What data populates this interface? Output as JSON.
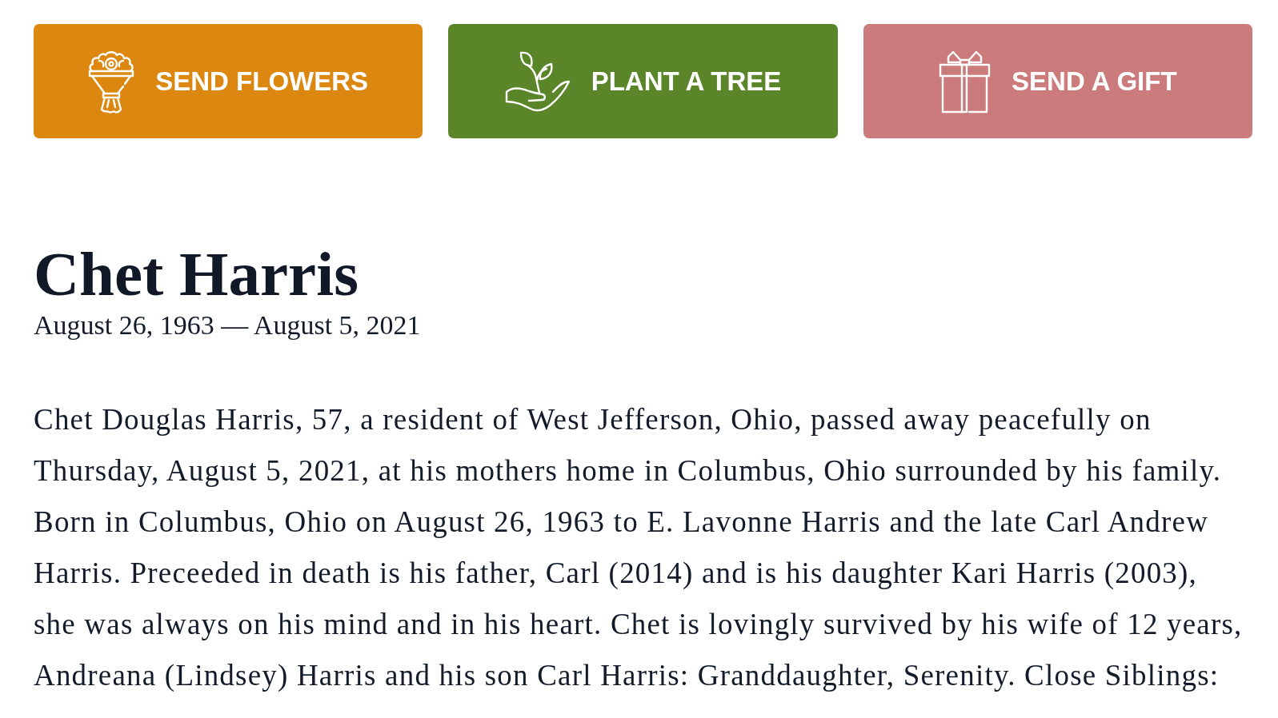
{
  "actions": [
    {
      "kind": "flowers",
      "label": "SEND FLOWERS",
      "color": "#dc870f"
    },
    {
      "kind": "tree",
      "label": "PLANT A TREE",
      "color": "#5a8629"
    },
    {
      "kind": "gift",
      "label": "SEND A GIFT",
      "color": "#cb7b7b"
    }
  ],
  "obituary": {
    "name": "Chet Harris",
    "dates": "August 26, 1963 — August 5, 2021",
    "text": "Chet Douglas Harris, 57, a resident of West Jefferson, Ohio, passed away peacefully on Thursday, August 5, 2021, at his mothers home in Columbus, Ohio surrounded by his family. Born in Columbus, Ohio on August 26, 1963 to E. Lavonne Harris and the late Carl Andrew Harris. Preceeded in death is his father, Carl (2014) and is his daughter Kari Harris (2003), she was always on his mind and in his heart. Chet is lovingly survived by his wife of 12 years, Andreana (Lindsey) Harris and his son Carl Harris: Granddaughter, Serenity. Close Siblings:"
  }
}
